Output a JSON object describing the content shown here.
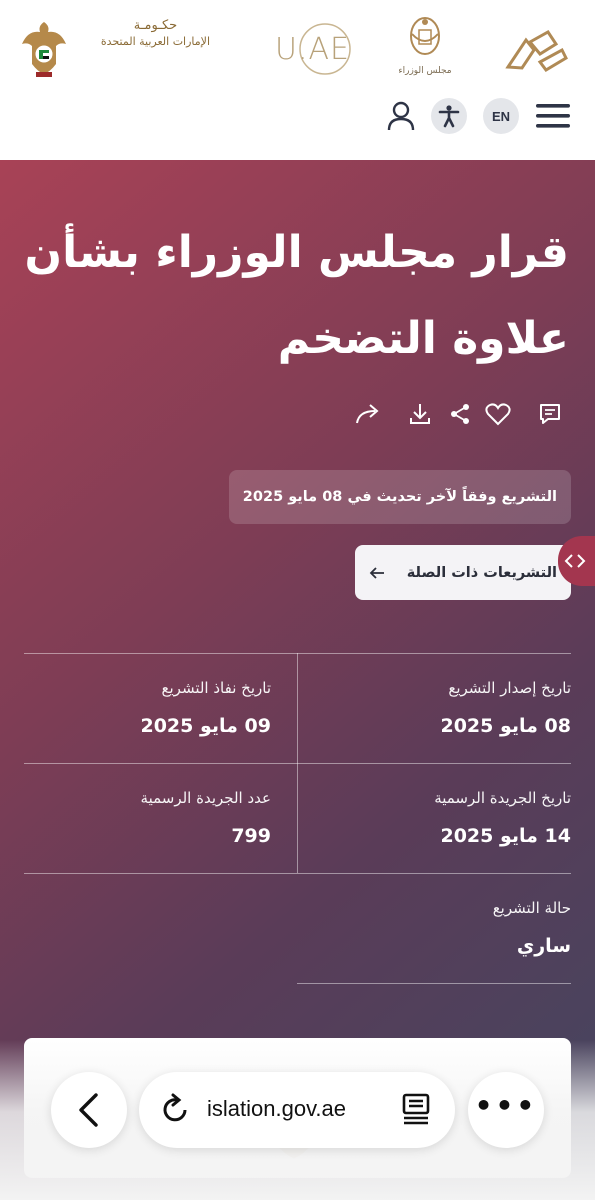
{
  "header": {
    "gov_logo": {
      "line1": "حكـومـة",
      "line2": "الإمارات العربية المتحدة"
    },
    "uae_logo_text": "U.AE",
    "cabinet_logo_text": "مجلس الوزراء",
    "lang_button": "EN"
  },
  "page": {
    "title": "قرار مجلس الوزراء بشأن علاوة التضخم",
    "updated_note": "التشريع وفقاً لآخر تحديث في 08 مايو 2025",
    "related_button": "التشريعات ذات الصلة",
    "details": {
      "issue_date": {
        "label": "تاريخ إصدار التشريع",
        "value": "08 مايو 2025"
      },
      "effective_date": {
        "label": "تاريخ نفاذ التشريع",
        "value": "09 مايو 2025"
      },
      "gazette_date": {
        "label": "تاريخ الجريدة الرسمية",
        "value": "14 مايو 2025"
      },
      "gazette_number": {
        "label": "عدد الجريدة الرسمية",
        "value": "799"
      },
      "status": {
        "label": "حالة التشريع",
        "value": "ساري"
      }
    }
  },
  "browser": {
    "url": "islation.gov.ae"
  },
  "icons": [
    "user-icon",
    "accessibility-icon",
    "menu-icon",
    "feedback-icon",
    "heart-icon",
    "share-icon",
    "download-icon",
    "forward-icon",
    "arrow-left-icon",
    "chevron-icon",
    "back-icon",
    "reload-icon",
    "reader-icon",
    "more-icon"
  ],
  "colors": {
    "hero_gradient_start": "#a84256",
    "hero_gradient_end": "#434660",
    "side_tab": "#a3364f",
    "gold": "#b8a27a"
  }
}
